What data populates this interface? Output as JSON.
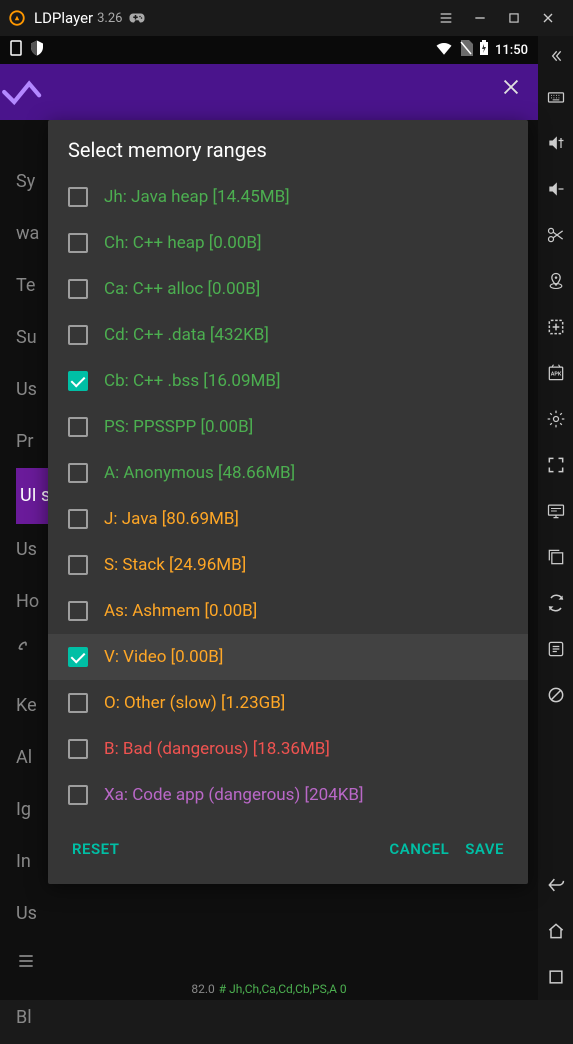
{
  "titlebar": {
    "name": "LDPlayer",
    "version": "3.26"
  },
  "status": {
    "time": "11:50"
  },
  "dialog": {
    "title": "Select memory ranges",
    "items": [
      {
        "label": "Jh: Java heap [14.45MB]",
        "checked": false,
        "color": "green"
      },
      {
        "label": "Ch: C++ heap [0.00B]",
        "checked": false,
        "color": "green"
      },
      {
        "label": "Ca: C++ alloc [0.00B]",
        "checked": false,
        "color": "green"
      },
      {
        "label": "Cd: C++ .data [432KB]",
        "checked": false,
        "color": "green"
      },
      {
        "label": "Cb: C++ .bss [16.09MB]",
        "checked": true,
        "color": "green"
      },
      {
        "label": "PS: PPSSPP [0.00B]",
        "checked": false,
        "color": "green"
      },
      {
        "label": "A: Anonymous [48.66MB]",
        "checked": false,
        "color": "green"
      },
      {
        "label": "J: Java [80.69MB]",
        "checked": false,
        "color": "orange"
      },
      {
        "label": "S: Stack [24.96MB]",
        "checked": false,
        "color": "orange"
      },
      {
        "label": "As: Ashmem [0.00B]",
        "checked": false,
        "color": "orange"
      },
      {
        "label": "V: Video [0.00B]",
        "checked": true,
        "color": "orange",
        "highlight": true
      },
      {
        "label": "O: Other (slow) [1.23GB]",
        "checked": false,
        "color": "orange"
      },
      {
        "label": "B: Bad (dangerous) [18.36MB]",
        "checked": false,
        "color": "red"
      },
      {
        "label": "Xa: Code app (dangerous) [204KB]",
        "checked": false,
        "color": "purple"
      }
    ],
    "reset": "RESET",
    "cancel": "CANCEL",
    "save": "SAVE"
  },
  "bg": {
    "items": [
      "Sy",
      "wa",
      "Te",
      "Su",
      "Us",
      "Pr",
      "UI set",
      "Us",
      "Ho",
      "",
      "Ke",
      "Al",
      "Ig",
      "In",
      "Us",
      "",
      "Bl"
    ]
  },
  "footer": {
    "left": "82.0",
    "right": "# Jh,Ch,Ca,Cd,Cb,PS,A 0"
  }
}
